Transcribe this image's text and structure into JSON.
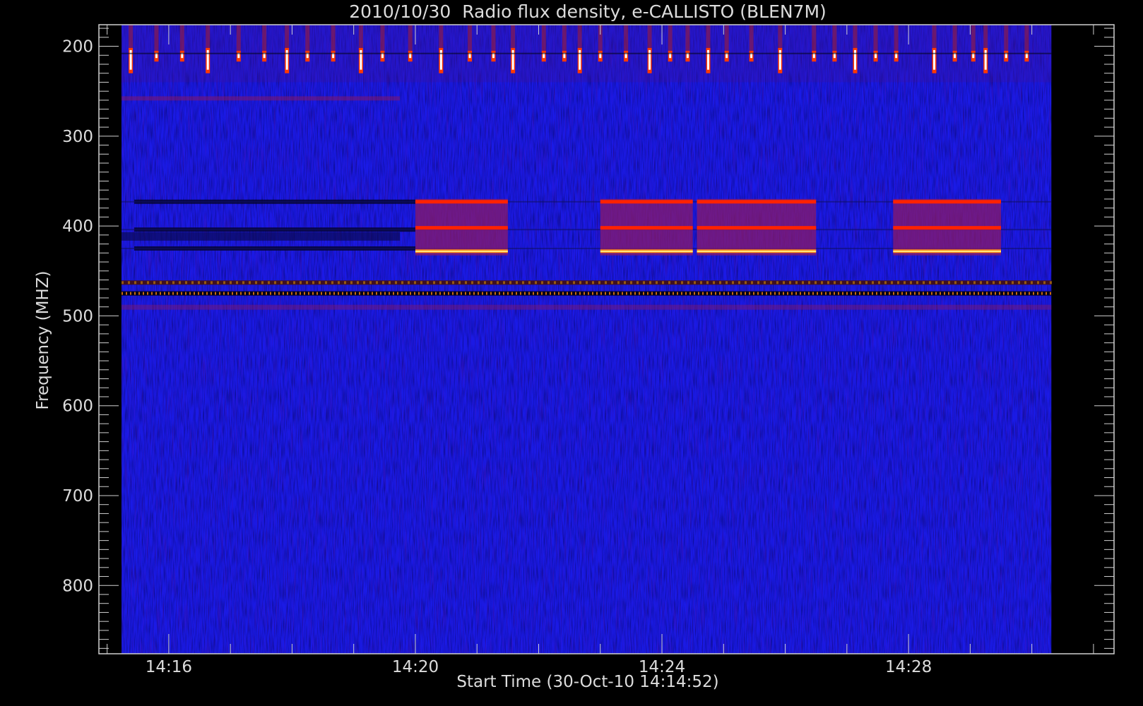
{
  "chart_data": {
    "type": "heatmap",
    "title": "2010/10/30  Radio flux density, e-CALLISTO (BLEN7M)",
    "xlabel": "Start Time (30-Oct-10 14:14:52)",
    "ylabel": "Frequency (MHZ)",
    "x_range_minutes": [
      "14:14:52",
      "14:31:20"
    ],
    "data_time_range": [
      "14:15:14",
      "14:30:19"
    ],
    "ylim": [
      876,
      176
    ],
    "data_freq_range": [
      876,
      176
    ],
    "y_ticks": [
      200,
      300,
      400,
      500,
      600,
      700,
      800
    ],
    "x_ticks": [
      "14:16",
      "14:20",
      "14:24",
      "14:28"
    ],
    "colormap": [
      "#000000",
      "#0000ff",
      "#ff0000",
      "#ffff00",
      "#ffffff"
    ],
    "background_color": "#1a1ae6",
    "features": {
      "periodic_bursts_mhz": [
        205,
        230
      ],
      "periodic_burst_times": [
        "14:15:23",
        "14:15:48",
        "14:16:13",
        "14:16:38",
        "14:17:08",
        "14:17:33",
        "14:17:55",
        "14:18:15",
        "14:18:40",
        "14:19:07",
        "14:19:28",
        "14:19:55",
        "14:20:25",
        "14:20:53",
        "14:21:16",
        "14:21:35",
        "14:22:05",
        "14:22:25",
        "14:22:40",
        "14:23:00",
        "14:23:25",
        "14:23:48",
        "14:24:08",
        "14:24:25",
        "14:24:45",
        "14:25:03",
        "14:25:27",
        "14:25:55",
        "14:26:28",
        "14:26:48",
        "14:27:08",
        "14:27:28",
        "14:27:48",
        "14:28:25",
        "14:28:45",
        "14:29:03",
        "14:29:15",
        "14:29:35",
        "14:29:55"
      ],
      "emission_blocks": [
        {
          "start": "14:20:00",
          "end": "14:21:30"
        },
        {
          "start": "14:23:00",
          "end": "14:24:30"
        },
        {
          "start": "14:24:34",
          "end": "14:26:30"
        },
        {
          "start": "14:27:45",
          "end": "14:29:30"
        }
      ],
      "emission_lines_mhz": [
        373,
        402,
        428
      ],
      "dark_lines_mhz": [
        373,
        404,
        425
      ],
      "constant_interference_mhz": [
        463,
        475
      ],
      "background_band_mhz": [
        258,
        490
      ]
    }
  }
}
